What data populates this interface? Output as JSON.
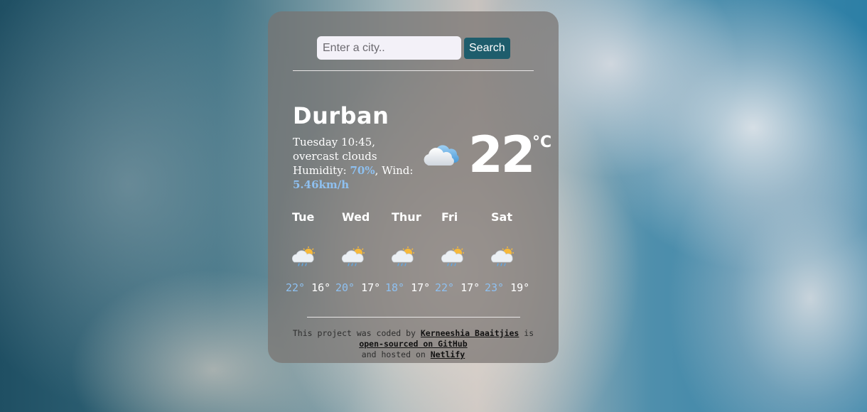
{
  "search": {
    "placeholder": "Enter a city..",
    "value": "",
    "button_label": "Search"
  },
  "current": {
    "city": "Durban",
    "day_time": "Tuesday 10:45",
    "description": "overcast clouds",
    "humidity_label": "Humidity:",
    "humidity": "70%",
    "wind_label": "Wind:",
    "wind": "5.46km/h",
    "temperature": "22",
    "unit": "°C",
    "icon": "cloud-icon"
  },
  "forecast": [
    {
      "day": "Tue",
      "max": "22°",
      "min": "16°",
      "icon": "sun-rain-cloud-icon"
    },
    {
      "day": "Wed",
      "max": "20°",
      "min": "17°",
      "icon": "sun-rain-cloud-icon"
    },
    {
      "day": "Thur",
      "max": "18°",
      "min": "17°",
      "icon": "sun-rain-cloud-icon"
    },
    {
      "day": "Fri",
      "max": "22°",
      "min": "17°",
      "icon": "sun-rain-cloud-icon"
    },
    {
      "day": "Sat",
      "max": "23°",
      "min": "19°",
      "icon": "sun-rain-cloud-icon"
    }
  ],
  "footer": {
    "prefix": "This project was coded by",
    "author": "Kerneeshia Baaitjies",
    "mid": "is",
    "source_link": "open-sourced on GitHub",
    "suffix": "and hosted on",
    "host_link": "Netlify"
  },
  "colors": {
    "accent": "#8ec0f0",
    "button": "#1e5d6c",
    "card": "#78736f"
  }
}
